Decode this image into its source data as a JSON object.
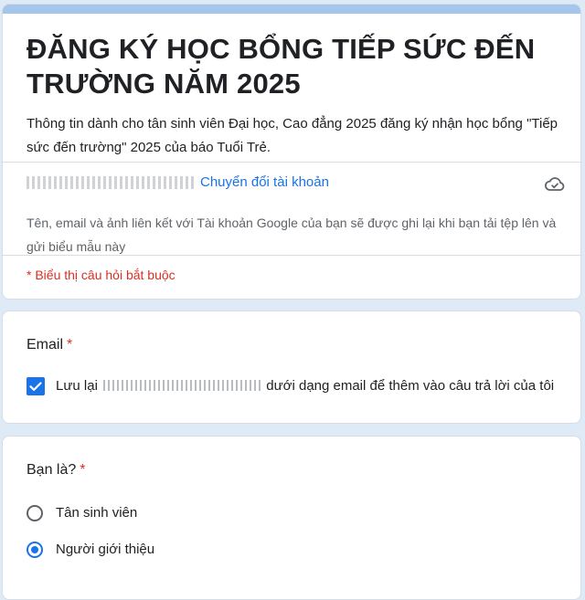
{
  "form": {
    "title": "ĐĂNG KÝ HỌC BỔNG TIẾP SỨC ĐẾN TRƯỜNG NĂM 2025",
    "description": "Thông tin dành cho tân sinh viên Đại học, Cao đẳng 2025 đăng ký nhận học bổng \"Tiếp sức đến trường\" 2025 của báo Tuổi Trẻ.",
    "switch_account_label": "Chuyển đổi tài khoản",
    "account_note": "Tên, email và ảnh liên kết với Tài khoản Google của bạn sẽ được ghi lại khi bạn tải tệp lên và gửi biểu mẫu này",
    "required_note": "* Biểu thị câu hỏi bắt buộc"
  },
  "questions": {
    "email": {
      "title": "Email",
      "required_mark": "*",
      "checkbox_prefix": "Lưu lại",
      "checkbox_suffix": "dưới dạng email để thêm vào câu trả lời của tôi",
      "checked": true
    },
    "role": {
      "title": "Bạn là?",
      "required_mark": "*",
      "options": [
        {
          "label": "Tân sinh viên",
          "selected": false
        },
        {
          "label": "Người giới thiệu",
          "selected": true
        }
      ]
    }
  },
  "colors": {
    "accent_bar": "#a3c6ea",
    "background": "#dfeaf7",
    "link": "#1a73e8",
    "required": "#d93025",
    "selected": "#1a73e8"
  }
}
